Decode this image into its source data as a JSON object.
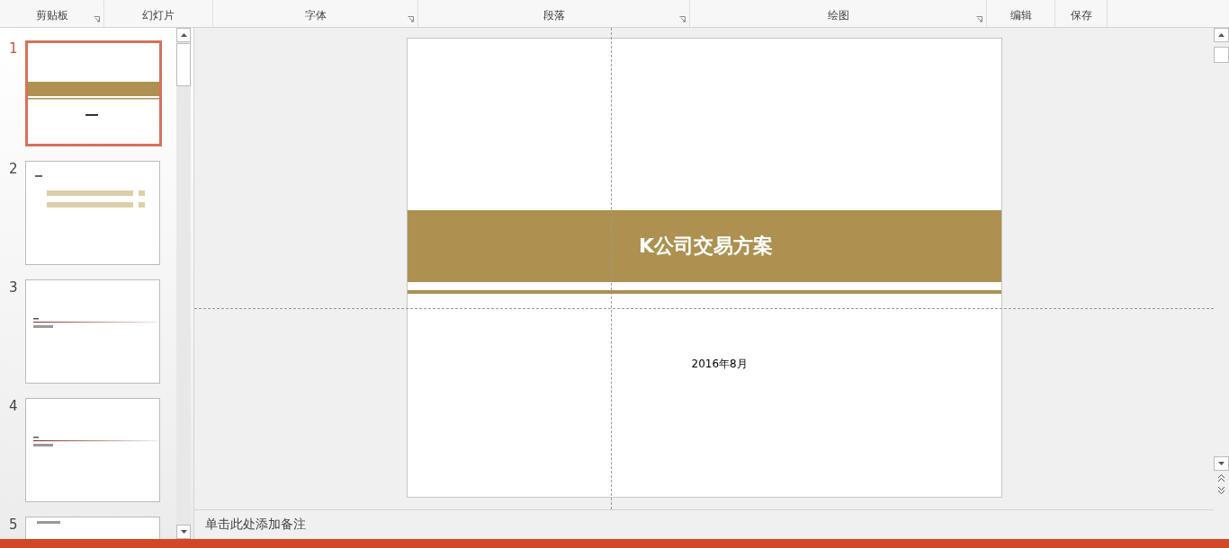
{
  "ribbon_groups": [
    {
      "label": "剪贴板",
      "launcher": true
    },
    {
      "label": "幻灯片",
      "launcher": false
    },
    {
      "label": "字体",
      "launcher": true
    },
    {
      "label": "段落",
      "launcher": true
    },
    {
      "label": "绘图",
      "launcher": true
    },
    {
      "label": "编辑",
      "launcher": false
    },
    {
      "label": "保存",
      "launcher": false
    }
  ],
  "thumbnails": [
    {
      "number": "1",
      "selected": true,
      "kind": "title"
    },
    {
      "number": "2",
      "selected": false,
      "kind": "toc"
    },
    {
      "number": "3",
      "selected": false,
      "kind": "section"
    },
    {
      "number": "4",
      "selected": false,
      "kind": "section"
    },
    {
      "number": "5",
      "selected": false,
      "kind": "heading"
    }
  ],
  "slide": {
    "title": "K公司交易方案",
    "date": "2016年8月"
  },
  "notes": {
    "placeholder": "单击此处添加备注"
  }
}
